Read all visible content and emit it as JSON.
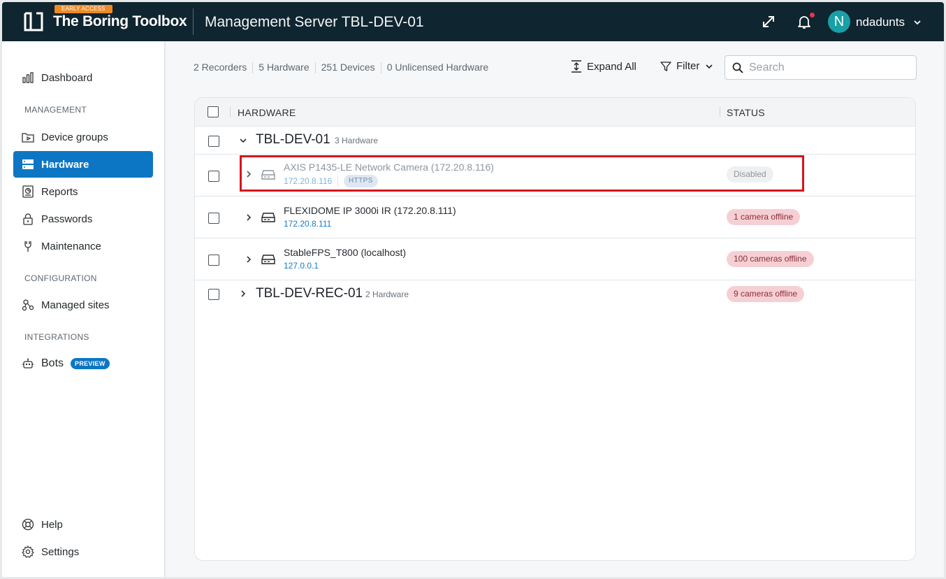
{
  "header": {
    "badge": "EARLY ACCESS",
    "app_title": "The Boring Toolbox",
    "server_title": "Management Server TBL-DEV-01",
    "avatar_letter": "N",
    "username": "ndadunts"
  },
  "sidebar": {
    "dashboard": "Dashboard",
    "management_label": "MANAGEMENT",
    "device_groups": "Device groups",
    "hardware": "Hardware",
    "reports": "Reports",
    "passwords": "Passwords",
    "maintenance": "Maintenance",
    "configuration_label": "CONFIGURATION",
    "managed_sites": "Managed sites",
    "integrations_label": "INTEGRATIONS",
    "bots": "Bots",
    "bots_badge": "PREVIEW",
    "help": "Help",
    "settings": "Settings"
  },
  "stats": {
    "recorders": "2 Recorders",
    "hardware": "5 Hardware",
    "devices": "251 Devices",
    "unlicensed": "0 Unlicensed Hardware"
  },
  "toolbar": {
    "expand_all": "Expand All",
    "filter": "Filter",
    "search_placeholder": "Search"
  },
  "table": {
    "col_hardware": "HARDWARE",
    "col_status": "STATUS",
    "groups": [
      {
        "name": "TBL-DEV-01",
        "count": "3 Hardware",
        "items": [
          {
            "name": "AXIS P1435-LE Network Camera (172.20.8.116)",
            "ip": "172.20.8.116",
            "tag": "HTTPS",
            "status": "Disabled"
          },
          {
            "name": "FLEXIDOME IP 3000i IR (172.20.8.111)",
            "ip": "172.20.8.111",
            "status": "1 camera offline"
          },
          {
            "name": "StableFPS_T800 (localhost)",
            "ip": "127.0.0.1",
            "status": "100 cameras offline"
          }
        ]
      },
      {
        "name": "TBL-DEV-REC-01",
        "count": "2 Hardware",
        "status": "9 cameras offline"
      }
    ]
  },
  "colors": {
    "header_bg": "#0f2530",
    "accent": "#0d76c4",
    "offline_pill": "#f6cfd4",
    "highlight": "#d9121e"
  }
}
